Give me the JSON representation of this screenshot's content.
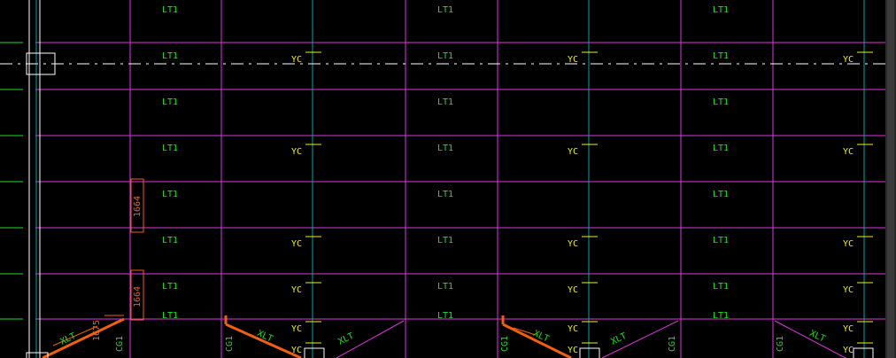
{
  "labels": {
    "lt1": "LT1",
    "yc": "YC",
    "cg1": "CG1",
    "xlt": "XLT",
    "dim_a": "1664",
    "dim_b": "1664",
    "dim_c": "1675"
  },
  "colors": {
    "background": "#000000",
    "beam_magenta": "#e036e0",
    "column_cyan": "#00a8a8",
    "lt1_green": "#22e022",
    "yc_yellow": "#f0f020",
    "stair_orange": "#f06010",
    "axis_white": "#ffffff",
    "scrollbar": "#2b2b2b"
  }
}
